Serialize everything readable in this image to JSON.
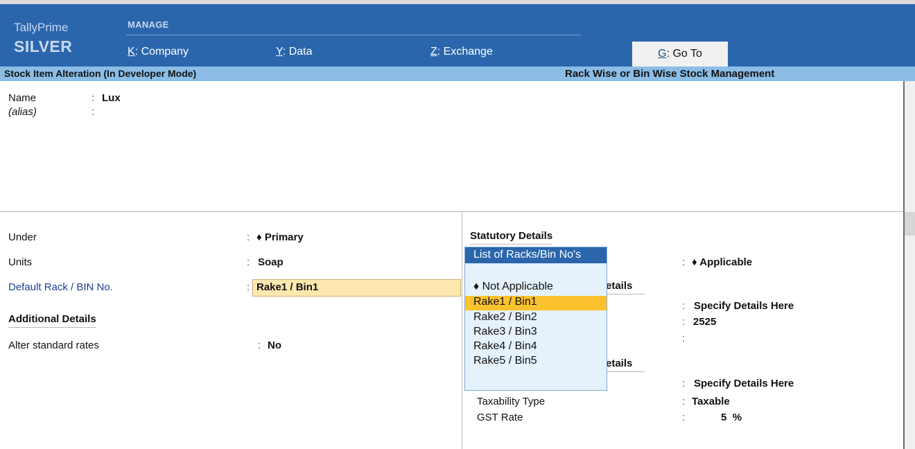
{
  "brand": {
    "name": "TallyPrime",
    "edition": "SILVER"
  },
  "top_menu": {
    "group_label": "MANAGE",
    "items": [
      {
        "key": "K",
        "label": "Company"
      },
      {
        "key": "Y",
        "label": "Data"
      },
      {
        "key": "Z",
        "label": "Exchange"
      }
    ],
    "goto": {
      "key": "G",
      "label": "Go To"
    }
  },
  "title_bar": {
    "left": "Stock Item Alteration (In Developer Mode)",
    "right": "Rack Wise or Bin Wise Stock Management"
  },
  "name_section": {
    "name_label": "Name",
    "name_value": "Lux",
    "alias_label": "(alias)",
    "alias_value": ""
  },
  "left_fields": {
    "under_label": "Under",
    "under_value": "Primary",
    "units_label": "Units",
    "units_value": "Soap",
    "rack_label": "Default Rack / BIN No.",
    "rack_value": "Rake1 / Bin1",
    "additional_heading": "Additional Details",
    "alter_rates_label": "Alter standard rates",
    "alter_rates_value": "No"
  },
  "right_fields": {
    "statutory_heading": "Statutory Details",
    "applicable_value": "Applicable",
    "hidden_heading_1_tail": "etails",
    "specify_1": "Specify Details Here",
    "code_value": "2525",
    "hidden_heading_2_tail": "etails",
    "specify_2": "Specify Details Here",
    "taxability_label": "Taxability Type",
    "taxability_value": "Taxable",
    "gst_label": "GST Rate",
    "gst_value": "5",
    "gst_unit": "%"
  },
  "rack_popup": {
    "title": "List of Racks/Bin No's",
    "not_applicable": "Not Applicable",
    "items": [
      "Rake1 / Bin1",
      "Rake2 / Bin2",
      "Rake3 / Bin3",
      "Rake4 / Bin4",
      "Rake5 / Bin5"
    ],
    "selected": "Rake1 / Bin1"
  },
  "colors": {
    "header_bg": "#2b66ad",
    "title_bar_bg": "#8bbde6",
    "selection_bg": "#fbc22e",
    "input_bg": "#fde9b0",
    "popup_bg": "#e5f1fb"
  }
}
